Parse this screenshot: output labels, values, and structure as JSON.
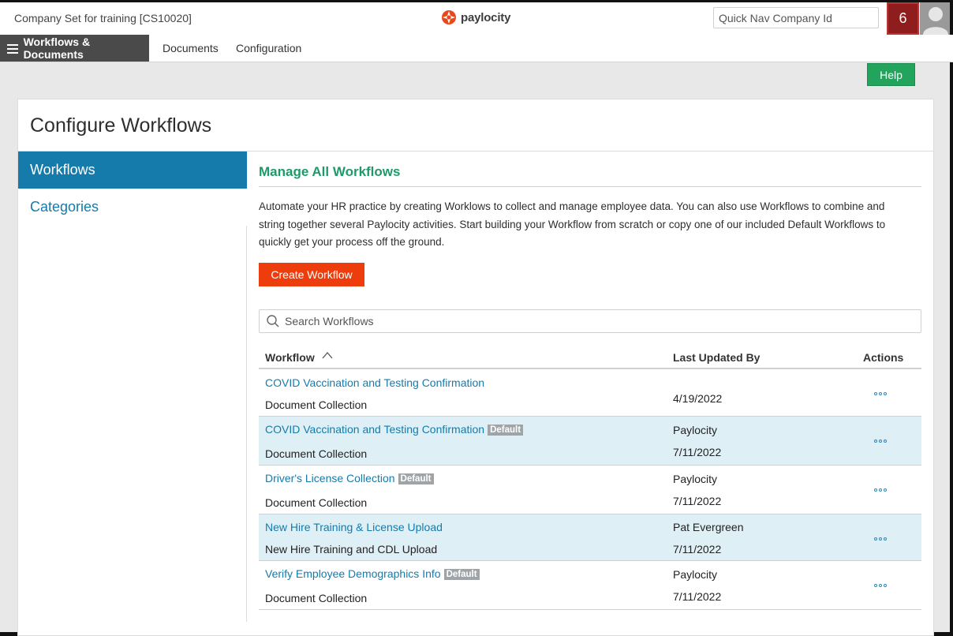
{
  "header": {
    "company": "Company Set for training [CS10020]",
    "brand": "paylocity",
    "quicknav_placeholder": "Quick Nav Company Id",
    "notification_count": "6"
  },
  "nav": {
    "primary": "Workflows & Documents",
    "links": [
      "Documents",
      "Configuration"
    ]
  },
  "help_label": "Help",
  "page": {
    "title": "Configure Workflows",
    "sidebar": [
      "Workflows",
      "Categories"
    ],
    "section_title": "Manage All Workflows",
    "intro_lines": [
      "Automate your HR practice by creating Worklows to collect and manage employee data. You can also use Workflows to combine and",
      "string together several Paylocity activities. Start building your Workflow from scratch or copy one of our included Default Workflows to",
      "quickly get your process off the ground."
    ],
    "create_label": "Create Workflow",
    "search_placeholder": "Search Workflows"
  },
  "table": {
    "columns": [
      "Workflow",
      "Last Updated By",
      "Actions"
    ],
    "badge_label": "Default",
    "rows": [
      {
        "name": "COVID Vaccination and Testing Confirmation",
        "category": "Document Collection",
        "updated_by": "",
        "date": "4/19/2022",
        "default": false
      },
      {
        "name": "COVID Vaccination and Testing Confirmation",
        "category": "Document Collection",
        "updated_by": "Paylocity",
        "date": "7/11/2022",
        "default": true
      },
      {
        "name": "Driver's License Collection",
        "category": "Document Collection",
        "updated_by": "Paylocity",
        "date": "7/11/2022",
        "default": true
      },
      {
        "name": "New Hire Training & License Upload",
        "category": "New Hire Training and CDL Upload",
        "updated_by": "Pat Evergreen",
        "date": "7/11/2022",
        "default": false
      },
      {
        "name": "Verify Employee Demographics Info",
        "category": "Document Collection",
        "updated_by": "Paylocity",
        "date": "7/11/2022",
        "default": true
      }
    ]
  },
  "colors": {
    "brand_blue": "#157bab",
    "create_orange": "#ee3d0d",
    "help_green": "#22a45d",
    "section_green": "#1e9a6a",
    "row_highlight": "#deeff6"
  }
}
